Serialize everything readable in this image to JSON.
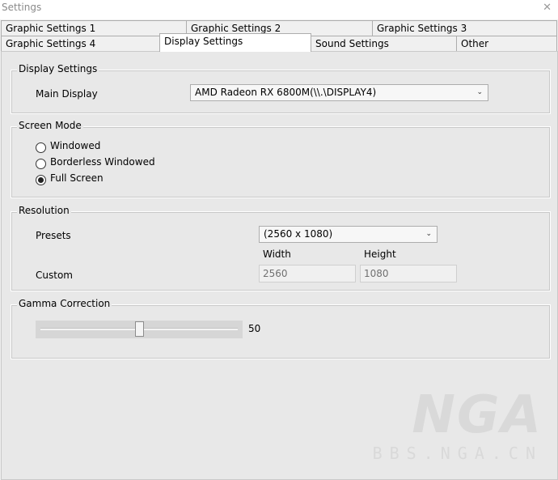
{
  "window": {
    "title": "Settings",
    "close_glyph": "✕"
  },
  "tabs": {
    "row1": [
      "Graphic Settings 1",
      "Graphic Settings 2",
      "Graphic Settings 3"
    ],
    "row2": [
      "Graphic Settings 4",
      "Display Settings",
      "Sound Settings",
      "Other"
    ],
    "active": "Display Settings"
  },
  "display_settings": {
    "legend": "Display Settings",
    "main_display_label": "Main Display",
    "main_display_value": "AMD Radeon RX 6800M(\\\\.\\DISPLAY4)"
  },
  "screen_mode": {
    "legend": "Screen Mode",
    "options": [
      "Windowed",
      "Borderless Windowed",
      "Full Screen"
    ],
    "selected": "Full Screen"
  },
  "resolution": {
    "legend": "Resolution",
    "presets_label": "Presets",
    "presets_value": "(2560 x 1080)",
    "width_label": "Width",
    "height_label": "Height",
    "custom_label": "Custom",
    "width_value": "2560",
    "height_value": "1080"
  },
  "gamma": {
    "legend": "Gamma Correction",
    "value": "50",
    "fraction": 0.5
  },
  "watermark": {
    "logo_text": "NGA",
    "url_text": "BBS.NGA.CN"
  },
  "icons": {
    "combo_arrow": "chevron-down-icon",
    "close": "close-icon"
  }
}
